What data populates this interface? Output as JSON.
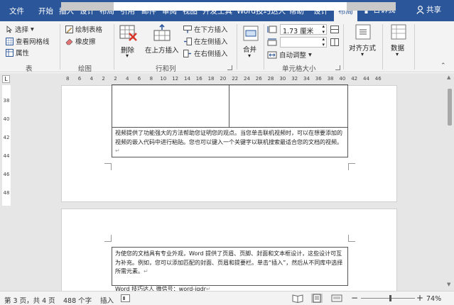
{
  "tabs": {
    "file": "文件",
    "home": "开始",
    "insert": "插入",
    "design": "设计",
    "layout": "布局",
    "references": "引用",
    "mailings": "邮件",
    "review": "审阅",
    "view": "视图",
    "developer": "开发工具",
    "word_tips": "Word技巧达人",
    "help": "帮助",
    "table_design": "设计",
    "table_layout": "布局"
  },
  "tell_me": "告诉我",
  "share": "共享",
  "ribbon": {
    "table": {
      "select": "选择",
      "gridlines": "查看网格线",
      "properties": "属性",
      "label": "表"
    },
    "draw": {
      "draw_table": "绘制表格",
      "eraser": "橡皮擦",
      "label": "绘图"
    },
    "rows_cols": {
      "delete": "删除",
      "insert_above": "在上方插入",
      "insert_below": "在下方插入",
      "insert_left": "在左侧插入",
      "insert_right": "在右侧插入",
      "label": "行和列"
    },
    "merge": {
      "merge": "合并"
    },
    "cell_size": {
      "height_value": "1.73 厘米",
      "autofit": "自动调整",
      "label": "单元格大小"
    },
    "alignment": {
      "label": "对齐方式"
    },
    "data": {
      "label": "数据"
    }
  },
  "ruler_numbers": [
    "8",
    "6",
    "4",
    "2",
    "2",
    "4",
    "6",
    "8",
    "10",
    "12",
    "14",
    "16",
    "18",
    "20",
    "22",
    "24",
    "26",
    "28",
    "30",
    "32",
    "34",
    "36",
    "38",
    "40",
    "42",
    "44",
    "46"
  ],
  "vruler_numbers": [
    "38",
    "40",
    "42",
    "44",
    "46",
    "48"
  ],
  "doc": {
    "para1": "视频提供了功能强大的方法帮助您证明您的观点。当您单击联机视频时，可以在想要添加的视频的嵌入代码中进行粘贴。您也可以键入一个关键字以联机搜索最适合您的文档的视频。",
    "para2": "为使您的文档具有专业外观，Word 提供了页眉、页脚、封面和文本框设计，这些设计可互为补充。例如，您可以添加匹配的封面、页眉和提要栏。单击“插入”，然后从不同库中选择所需元素。",
    "para3": "Word 技巧达人  微信号：word-jqdr"
  },
  "status": {
    "page": "第 3 页，共 4 页",
    "words": "488 个字",
    "mode": "插入",
    "zoom": "74%"
  },
  "colors": {
    "accent": "#2b579a",
    "ribbon_bg": "#f3f3f3",
    "doc_bg": "#e6e6e6"
  }
}
